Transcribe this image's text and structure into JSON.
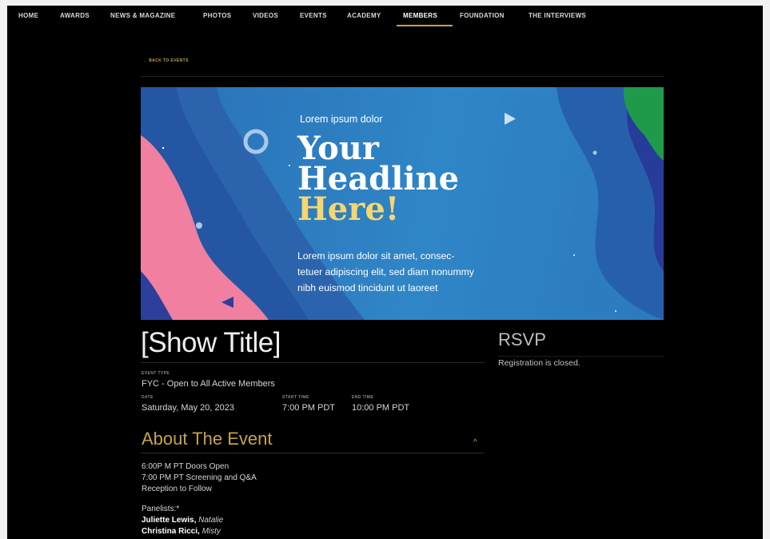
{
  "nav": {
    "items": [
      "HOME",
      "AWARDS",
      "NEWS & MAGAZINE",
      "PHOTOS",
      "VIDEOS",
      "EVENTS",
      "ACADEMY",
      "MEMBERS",
      "FOUNDATION",
      "THE INTERVIEWS"
    ],
    "active": "MEMBERS"
  },
  "back_link": "← BACK TO EVENTS",
  "banner": {
    "kicker": "Lorem ipsum dolor",
    "headline_line1": "Your",
    "headline_line2": "Headline",
    "headline_line3": "Here!",
    "body": "Lorem ipsum dolor sit amet, consectetuer adipiscing elit, sed diam nonummy nibh euismod tincidunt ut laoreet",
    "body_lines": [
      "Lorem ipsum dolor sit amet, consec-",
      "tetuer adipiscing elit, sed diam nonummy",
      "nibh euismod tincidunt ut laoreet"
    ]
  },
  "show": {
    "title": "[Show Title]",
    "event_type_label": "EVENT TYPE",
    "event_type": "FYC - Open to All Active Members",
    "date_label": "DATE",
    "date": "Saturday, May 20, 2023",
    "start_label": "START TIME",
    "start_time": "7:00 PM PDT",
    "end_label": "END TIME",
    "end_time": "10:00 PM PDT"
  },
  "about": {
    "title": "About The Event",
    "schedule": [
      "6:00P M PT Doors Open",
      "7:00 PM PT Screening and Q&A",
      "Reception to Follow"
    ],
    "panelists_label": "Panelists:*",
    "panelists": [
      {
        "name": "Juliette Lewis,",
        "role": "Natalie"
      },
      {
        "name": "Christina Ricci,",
        "role": "Misty"
      }
    ]
  },
  "rsvp": {
    "title": "RSVP",
    "status": "Registration is closed."
  },
  "colors": {
    "accent": "#c9a24a",
    "background": "#000000",
    "banner_blue": "#2f86c6",
    "headline_yellow": "#f9d56e",
    "pink": "#f07fa0",
    "green": "#1f9a4a"
  }
}
